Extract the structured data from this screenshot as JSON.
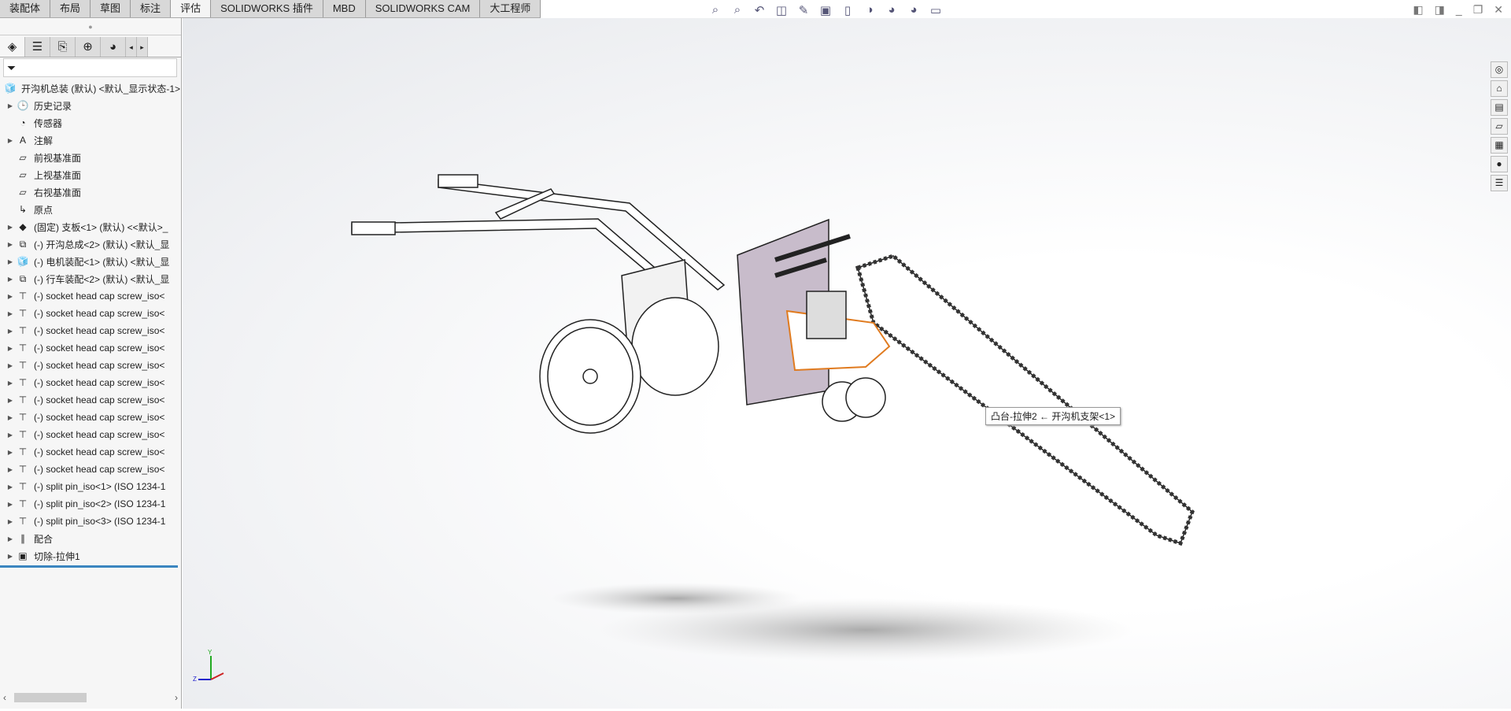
{
  "tabs": [
    "装配体",
    "布局",
    "草图",
    "标注",
    "评估",
    "SOLIDWORKS 插件",
    "MBD",
    "SOLIDWORKS CAM",
    "大工程师"
  ],
  "active_tab": "评估",
  "panel_tabs": [
    "featuremanager-icon",
    "propertymanager-icon",
    "configurationmanager-icon",
    "dimxpert-icon",
    "displaymanager-icon"
  ],
  "tree": [
    {
      "label": "开沟机总装 (默认) <默认_显示状态-1>",
      "icon": "assembly-icon",
      "expand": false,
      "root": true
    },
    {
      "label": "历史记录",
      "icon": "history-folder-icon",
      "expand": true
    },
    {
      "label": "传感器",
      "icon": "sensor-folder-icon",
      "expand": false
    },
    {
      "label": "注解",
      "icon": "annotation-folder-icon",
      "expand": true
    },
    {
      "label": "前视基准面",
      "icon": "plane-icon",
      "expand": false
    },
    {
      "label": "上视基准面",
      "icon": "plane-icon",
      "expand": false
    },
    {
      "label": "右视基准面",
      "icon": "plane-icon",
      "expand": false
    },
    {
      "label": "原点",
      "icon": "origin-icon",
      "expand": false
    },
    {
      "label": "(固定) 支板<1> (默认) <<默认>_",
      "icon": "part-icon",
      "expand": true
    },
    {
      "label": "(-) 开沟总成<2> (默认) <默认_显",
      "icon": "subassembly-icon",
      "expand": true
    },
    {
      "label": "(-) 电机装配<1> (默认) <默认_显",
      "icon": "assembly-icon",
      "expand": true
    },
    {
      "label": "(-) 行车装配<2> (默认) <默认_显",
      "icon": "subassembly-icon",
      "expand": true
    },
    {
      "label": "(-) socket head cap screw_iso<",
      "icon": "screw-icon",
      "expand": true
    },
    {
      "label": "(-) socket head cap screw_iso<",
      "icon": "screw-icon",
      "expand": true
    },
    {
      "label": "(-) socket head cap screw_iso<",
      "icon": "screw-icon",
      "expand": true
    },
    {
      "label": "(-) socket head cap screw_iso<",
      "icon": "screw-icon",
      "expand": true
    },
    {
      "label": "(-) socket head cap screw_iso<",
      "icon": "screw-icon",
      "expand": true
    },
    {
      "label": "(-) socket head cap screw_iso<",
      "icon": "screw-icon",
      "expand": true
    },
    {
      "label": "(-) socket head cap screw_iso<",
      "icon": "screw-icon",
      "expand": true
    },
    {
      "label": "(-) socket head cap screw_iso<",
      "icon": "screw-icon",
      "expand": true
    },
    {
      "label": "(-) socket head cap screw_iso<",
      "icon": "screw-icon",
      "expand": true
    },
    {
      "label": "(-) socket head cap screw_iso<",
      "icon": "screw-icon",
      "expand": true
    },
    {
      "label": "(-) socket head cap screw_iso<",
      "icon": "screw-icon",
      "expand": true
    },
    {
      "label": "(-) split pin_iso<1> (ISO 1234-1",
      "icon": "screw-icon",
      "expand": true
    },
    {
      "label": "(-) split pin_iso<2> (ISO 1234-1",
      "icon": "screw-icon",
      "expand": true
    },
    {
      "label": "(-) split pin_iso<3> (ISO 1234-1",
      "icon": "screw-icon",
      "expand": true
    },
    {
      "label": "配合",
      "icon": "mates-icon",
      "expand": true
    },
    {
      "label": "切除-拉伸1",
      "icon": "cut-extrude-icon",
      "expand": true
    }
  ],
  "toolbar": [
    "zoom-to-fit-icon",
    "zoom-to-area-icon",
    "previous-view-icon",
    "section-view-icon",
    "dynamic-annotation-icon",
    "view-orientation-icon",
    "display-style-icon",
    "hide-show-icon",
    "edit-appearance-icon",
    "apply-scene-icon",
    "view-settings-icon"
  ],
  "taskpane": [
    "resources-icon",
    "home-icon",
    "design-library-icon",
    "file-explorer-icon",
    "view-palette-icon",
    "appearances-icon",
    "custom-properties-icon"
  ],
  "tooltip": "凸台-拉伸2 ← 开沟机支架<1>",
  "colors": {
    "selection": "#e07b20",
    "plate": "#c8bccb",
    "tree_separator": "#3b86c0"
  }
}
